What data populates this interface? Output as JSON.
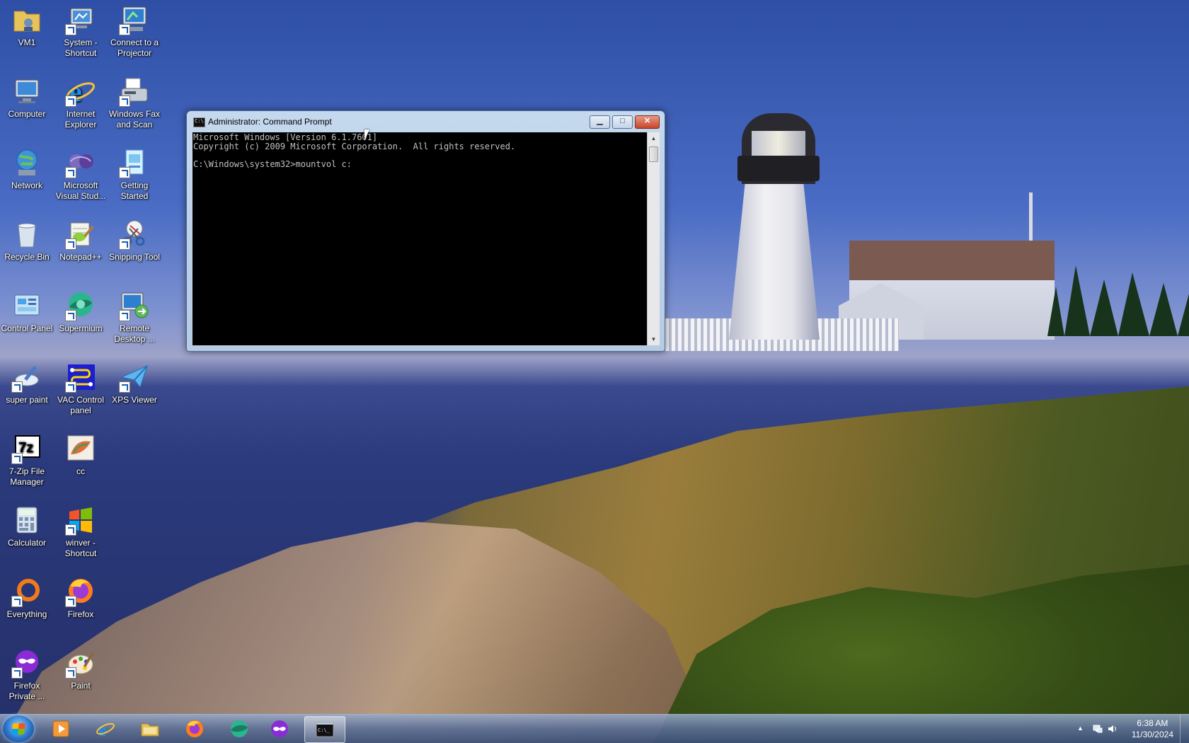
{
  "desktop": {
    "icons": [
      {
        "label": "VM1"
      },
      {
        "label": "System - Shortcut"
      },
      {
        "label": "Connect to a Projector"
      },
      {
        "label": "Computer"
      },
      {
        "label": "Internet Explorer"
      },
      {
        "label": "Windows Fax and Scan"
      },
      {
        "label": "Network"
      },
      {
        "label": "Microsoft Visual Stud..."
      },
      {
        "label": "Getting Started"
      },
      {
        "label": "Recycle Bin"
      },
      {
        "label": "Notepad++"
      },
      {
        "label": "Snipping Tool"
      },
      {
        "label": "Control Panel"
      },
      {
        "label": "Supermium"
      },
      {
        "label": "Remote Desktop ..."
      },
      {
        "label": "super paint"
      },
      {
        "label": "VAC Control panel"
      },
      {
        "label": "XPS Viewer"
      },
      {
        "label": "7-Zip File Manager"
      },
      {
        "label": "cc"
      },
      {
        "label": "Calculator"
      },
      {
        "label": "winver - Shortcut"
      },
      {
        "label": "Everything"
      },
      {
        "label": "Firefox"
      },
      {
        "label": "Firefox Private ..."
      },
      {
        "label": "Paint"
      }
    ]
  },
  "cmd": {
    "title": "Administrator: Command Prompt",
    "min_label": "▁",
    "max_label": "□",
    "close_label": "✕",
    "output": "Microsoft Windows [Version 6.1.7601]\nCopyright (c) 2009 Microsoft Corporation.  All rights reserved.\n\nC:\\Windows\\system32>mountvol c:"
  },
  "taskbar": {
    "time": "6:38 AM",
    "date": "11/30/2024"
  }
}
